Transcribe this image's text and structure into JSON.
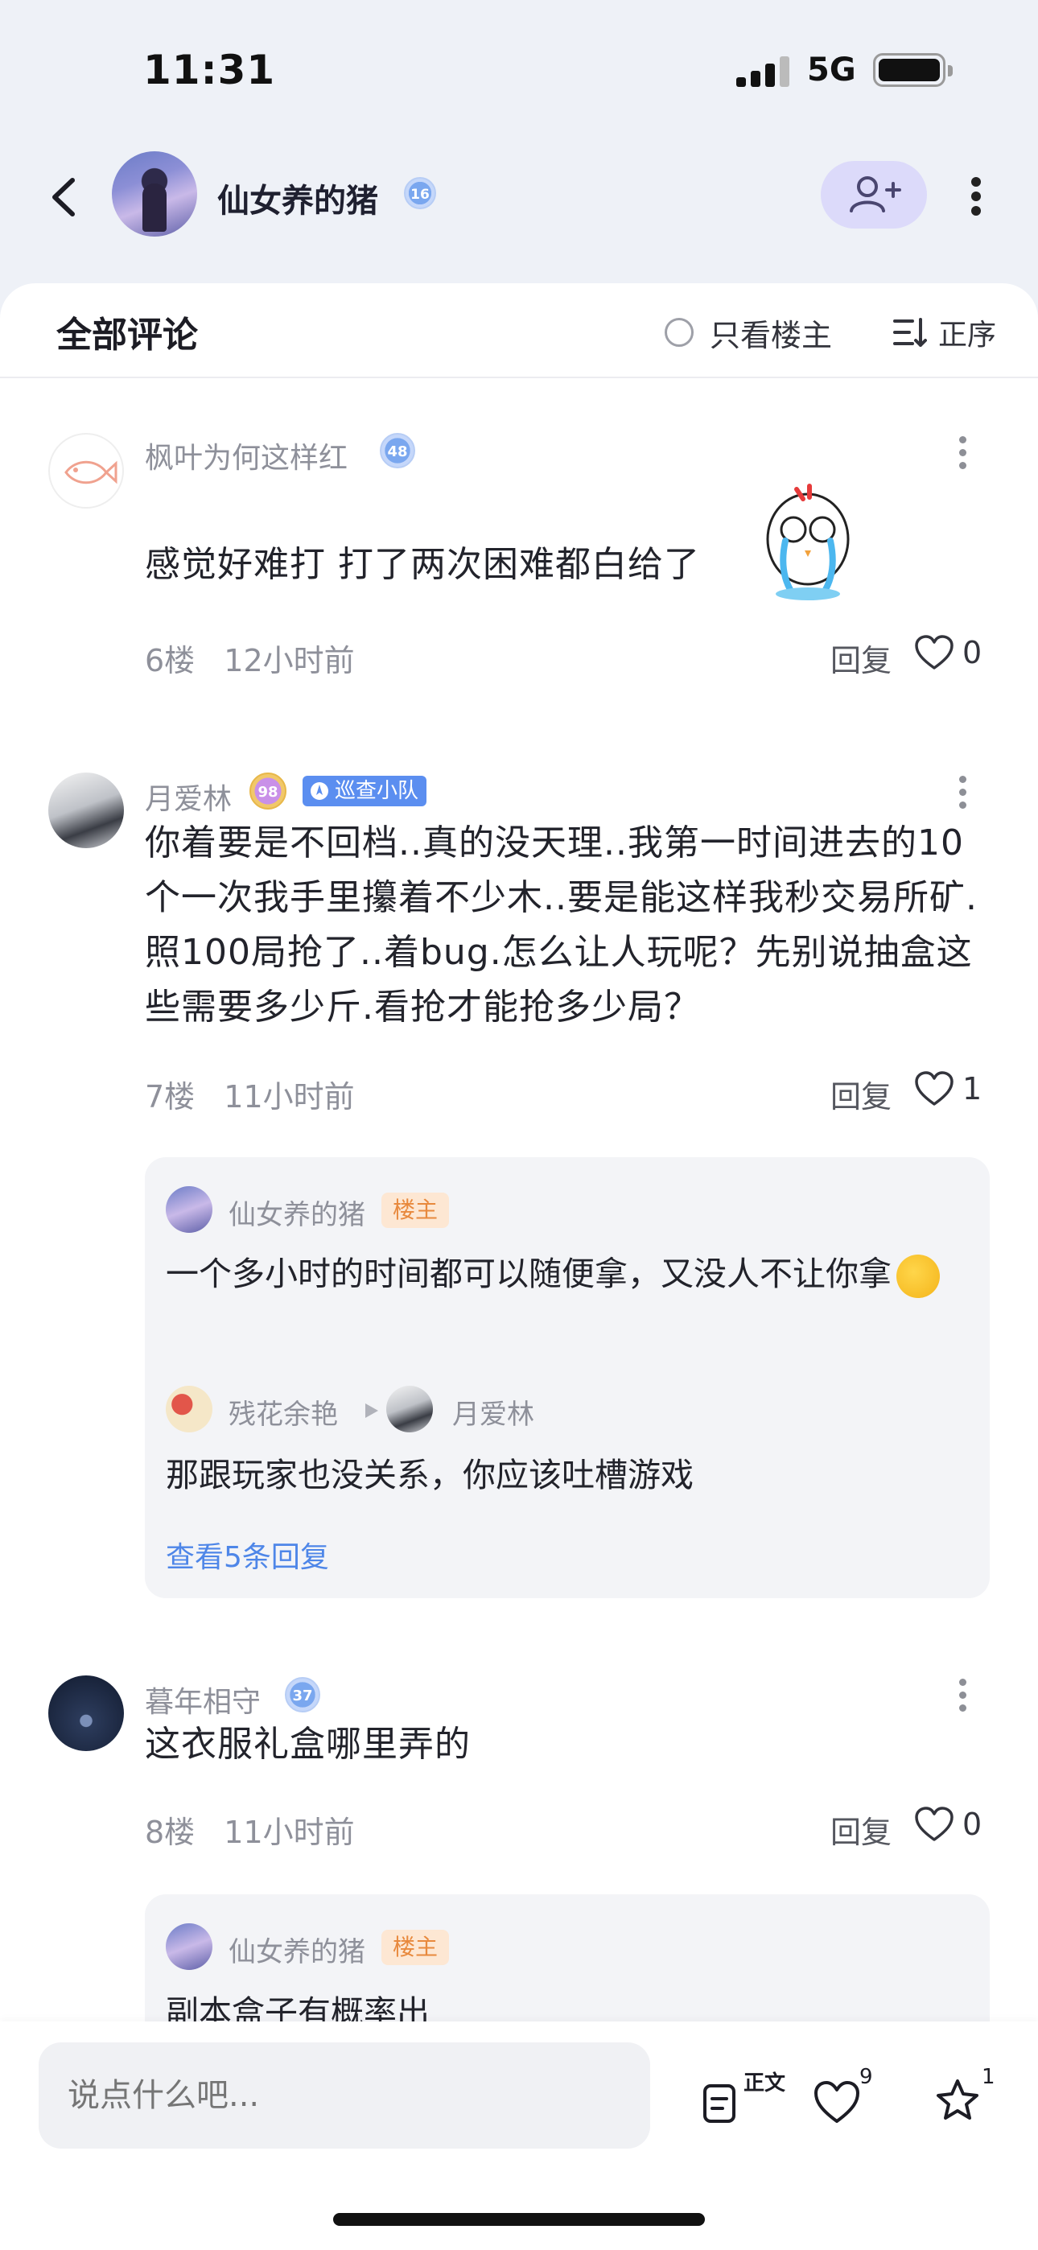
{
  "status": {
    "time": "11:31",
    "network": "5G"
  },
  "header": {
    "name": "仙女养的猪",
    "level": "16"
  },
  "tabbar": {
    "title": "全部评论",
    "only_op": "只看楼主",
    "sort": "正序"
  },
  "comments": [
    {
      "name": "枫叶为何这样红",
      "level": "48",
      "text": "感觉好难打 打了两次困难都白给了",
      "floor": "6楼",
      "time": "12小时前",
      "reply": "回复",
      "likes": "0"
    },
    {
      "name": "月爱林",
      "level": "98",
      "tag": "巡查小队",
      "text": "你着要是不回档..真的没天理..我第一时间进去的10个一次我手里攥着不少木..要是能这样我秒交易所矿.照100局抢了..着bug.怎么让人玩呢？先别说抽盒这些需要多少斤.看抢才能抢多少局？",
      "floor": "7楼",
      "time": "11小时前",
      "reply": "回复",
      "likes": "1",
      "replies": [
        {
          "name": "仙女养的猪",
          "tag": "楼主",
          "text": "一个多小时的时间都可以随便拿，又没人不让你拿"
        },
        {
          "name": "残花余艳",
          "to": "月爱林",
          "text": "那跟玩家也没关系，你应该吐槽游戏"
        }
      ],
      "view_more": "查看5条回复"
    },
    {
      "name": "暮年相守",
      "level": "37",
      "text": "这衣服礼盒哪里弄的",
      "floor": "8楼",
      "time": "11小时前",
      "reply": "回复",
      "likes": "0",
      "replies": [
        {
          "name": "仙女养的猪",
          "tag": "楼主",
          "text": "副本盒子有概率出"
        }
      ]
    }
  ],
  "bottom": {
    "placeholder": "说点什么吧...",
    "article_label": "正文",
    "likes": "9",
    "favorites": "1"
  },
  "colors": {
    "accent": "#5b8ef0",
    "op_tag": "#fde7d3",
    "follow_bg": "#dcdafa"
  }
}
